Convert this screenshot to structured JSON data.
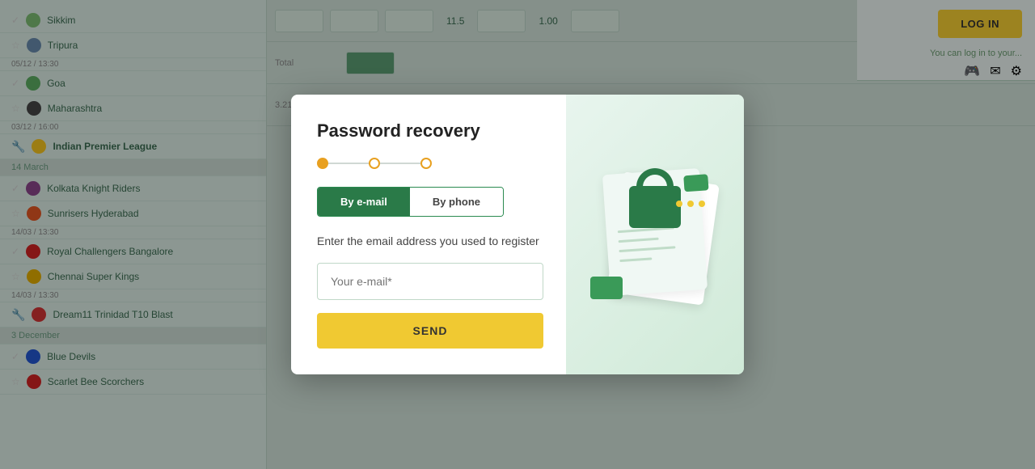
{
  "background": {
    "teams": [
      {
        "name": "Sikkim",
        "color": "#7ab870",
        "star": false
      },
      {
        "name": "Tripura",
        "color": "#6688aa",
        "star": true
      },
      {
        "name": "Goa",
        "color": "#5aaa60",
        "star": false
      },
      {
        "name": "Maharashtra",
        "color": "#444444",
        "star": true
      },
      {
        "name": "Indian Premier League",
        "color": "#f0c020",
        "star": false
      },
      {
        "section": "14 March"
      },
      {
        "name": "Kolkata Knight Riders",
        "color": "#884488",
        "star": false
      },
      {
        "name": "Sunrisers Hyderabad",
        "color": "#dd5522",
        "star": true
      },
      {
        "name": "Royal Challengers Bangalore",
        "color": "#cc2222",
        "star": false
      },
      {
        "name": "Chennai Super Kings",
        "color": "#ddaa00",
        "star": true
      },
      {
        "name": "Dream11 Trinidad T10 Blast",
        "color": "#cc3333",
        "star": false
      },
      {
        "section": "3 December"
      },
      {
        "name": "Blue Devils",
        "color": "#2255cc",
        "star": false
      },
      {
        "name": "Scarlet Bee Scorchers",
        "color": "#cc2222",
        "star": true
      }
    ],
    "logInLabel": "LOG IN"
  },
  "modal": {
    "title": "Password recovery",
    "closeLabel": "×",
    "progress": {
      "dots": [
        {
          "active": true
        },
        {
          "active": false
        },
        {
          "active": false
        }
      ]
    },
    "tabs": [
      {
        "label": "By e-mail",
        "active": true
      },
      {
        "label": "By phone",
        "active": false
      }
    ],
    "description": "Enter the email address you used to register",
    "emailPlaceholder": "Your e-mail*",
    "sendLabel": "SEND"
  }
}
